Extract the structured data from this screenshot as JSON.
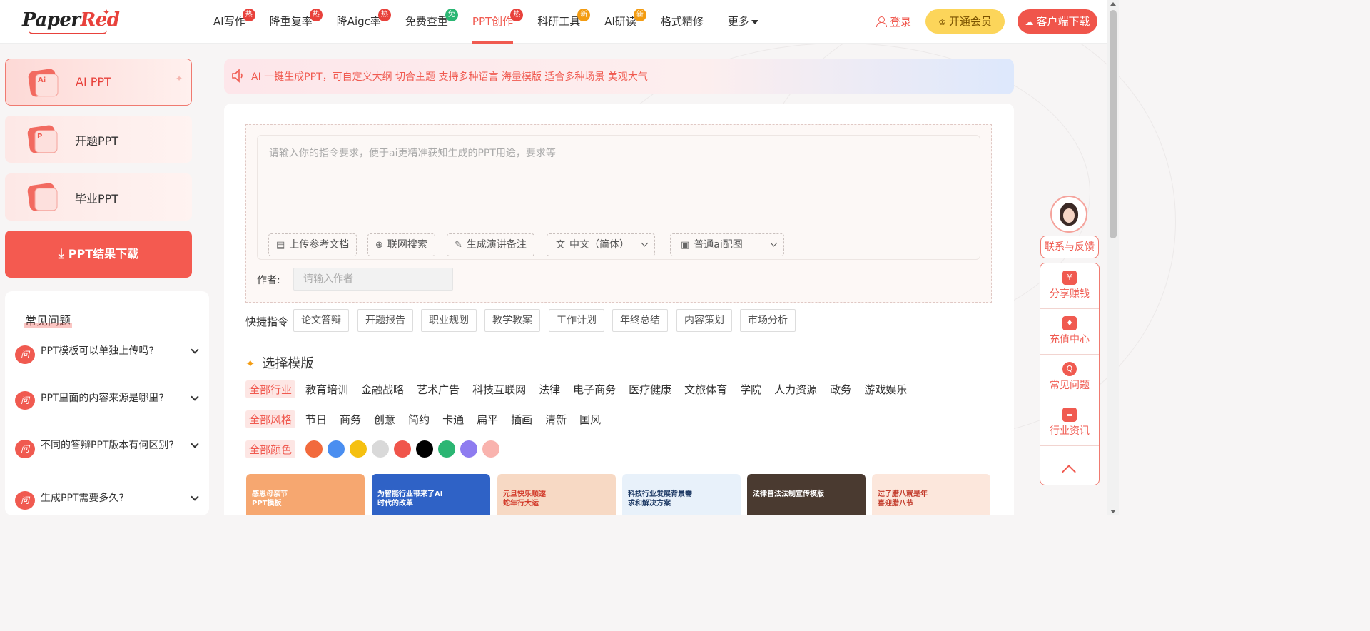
{
  "header": {
    "logo_main": "Paper",
    "logo_accent": "Red",
    "nav": [
      {
        "label": "AI写作",
        "badge": "热",
        "badge_color": "red"
      },
      {
        "label": "降重复率",
        "badge": "热",
        "badge_color": "red"
      },
      {
        "label": "降Aigc率",
        "badge": "热",
        "badge_color": "red"
      },
      {
        "label": "免费查重",
        "badge": "免",
        "badge_color": "green"
      },
      {
        "label": "PPT创作",
        "badge": "热",
        "badge_color": "red",
        "active": true
      },
      {
        "label": "科研工具",
        "badge": "新",
        "badge_color": "orange"
      },
      {
        "label": "AI研读",
        "badge": "新",
        "badge_color": "orange"
      },
      {
        "label": "格式精修"
      },
      {
        "label": "更多"
      }
    ],
    "login": "登录",
    "vip": "开通会员",
    "client_download": "客户端下载"
  },
  "sidebar": {
    "items": [
      {
        "label": "AI PPT",
        "icon_text": "Ai",
        "active": true
      },
      {
        "label": "开题PPT",
        "icon_text": "P"
      },
      {
        "label": "毕业PPT",
        "icon_text": ""
      }
    ],
    "download_label": "PPT结果下载",
    "faq_title": "常见问题",
    "faq_icon": "问",
    "faqs": [
      "PPT模板可以单独上传吗?",
      "PPT里面的内容来源是哪里?",
      "不同的答辩PPT版本有何区别?",
      "生成PPT需要多久?"
    ]
  },
  "notice": {
    "text": "AI 一键生成PPT，可自定义大纲 切合主题 支持多种语言 海量模版 适合多种场景 美观大气"
  },
  "editor": {
    "placeholder": "请输入你的指令要求，便于ai更精准获知生成的PPT用途，要求等",
    "tools": [
      {
        "label": "上传参考文档",
        "icon": "document-icon"
      },
      {
        "label": "联网搜索",
        "icon": "globe-icon"
      },
      {
        "label": "生成演讲备注",
        "icon": "pen-icon"
      },
      {
        "label": "中文（简体）",
        "icon": "translate-icon",
        "dropdown": true
      },
      {
        "label": "普通ai配图",
        "icon": "image-icon",
        "dropdown": true
      }
    ],
    "author_label": "作者:",
    "author_placeholder": "请输入作者"
  },
  "quick": {
    "label": "快捷指令",
    "items": [
      "论文答辩",
      "开题报告",
      "职业规划",
      "教学教案",
      "工作计划",
      "年终总结",
      "内容策划",
      "市场分析"
    ]
  },
  "templates": {
    "title": "选择模版",
    "industries": [
      "全部行业",
      "教育培训",
      "金融战略",
      "艺术广告",
      "科技互联网",
      "法律",
      "电子商务",
      "医疗健康",
      "文旅体育",
      "学院",
      "人力资源",
      "政务",
      "游戏娱乐"
    ],
    "styles": [
      "全部风格",
      "节日",
      "商务",
      "创意",
      "简约",
      "卡通",
      "扁平",
      "插画",
      "清新",
      "国风"
    ],
    "color_label": "全部颜色",
    "colors": [
      "#f26a3c",
      "#4a8ef0",
      "#f5c010",
      "#d9d9d9",
      "#f0554b",
      "#000000",
      "#2bb673",
      "#8e7cf0",
      "#f9b3ae"
    ],
    "thumbs": [
      {
        "title": "感恩母亲节\nPPT模板",
        "bg": "#f6a770",
        "fg": "#ffffff"
      },
      {
        "title": "为智能行业带来了AI\n时代的改革",
        "bg": "#2f62c6",
        "fg": "#ffffff"
      },
      {
        "title": "元旦快乐顺遂\n蛇年行大运",
        "bg": "#f7d9c4",
        "fg": "#d23a2a"
      },
      {
        "title": "科技行业发展背景需\n求和解决方案",
        "bg": "#e8f1fa",
        "fg": "#1f3b66"
      },
      {
        "title": "法律普法法制宣传模版",
        "bg": "#4a3a30",
        "fg": "#ffffff"
      },
      {
        "title": "过了腊八就是年\n喜迎腊八节",
        "bg": "#fce7dc",
        "fg": "#c23a2a"
      }
    ]
  },
  "float": {
    "contact": "联系与反馈",
    "items": [
      {
        "label": "分享赚钱",
        "icon": "¥"
      },
      {
        "label": "充值中心",
        "icon": "♦"
      },
      {
        "label": "常见问题",
        "icon": "Q"
      },
      {
        "label": "行业资讯",
        "icon": "≡"
      }
    ]
  }
}
